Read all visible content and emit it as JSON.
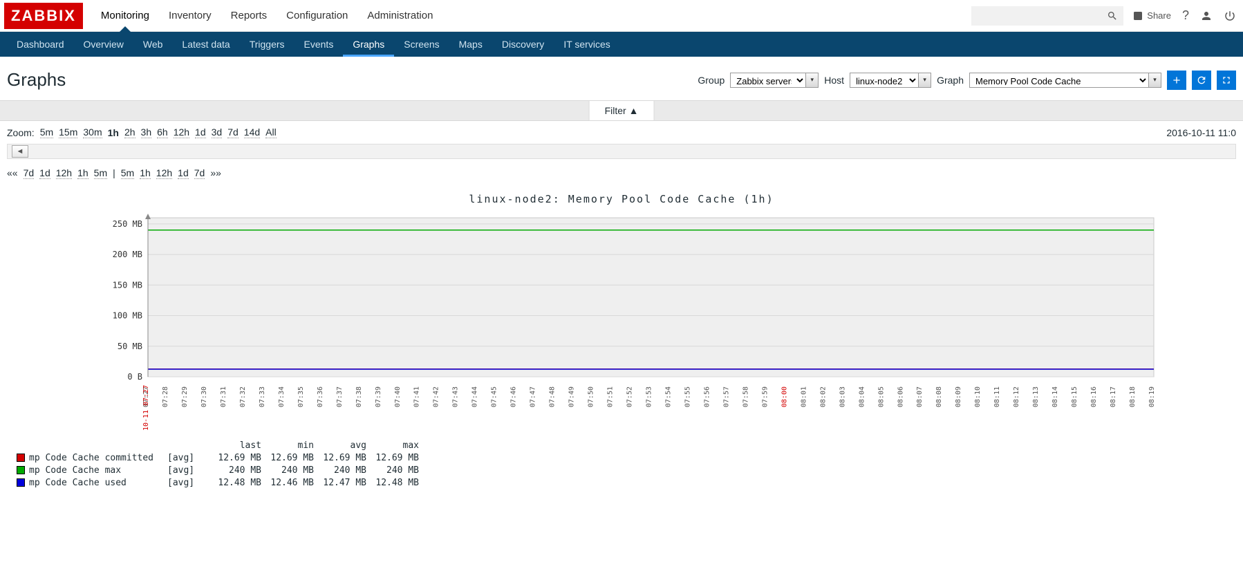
{
  "logo_text": "ZABBIX",
  "topnav": {
    "items": [
      "Monitoring",
      "Inventory",
      "Reports",
      "Configuration",
      "Administration"
    ],
    "active": "Monitoring",
    "share_label": "Share"
  },
  "subnav": {
    "items": [
      "Dashboard",
      "Overview",
      "Web",
      "Latest data",
      "Triggers",
      "Events",
      "Graphs",
      "Screens",
      "Maps",
      "Discovery",
      "IT services"
    ],
    "active": "Graphs"
  },
  "page_title": "Graphs",
  "selectors": {
    "group_label": "Group",
    "group_value": "Zabbix servers",
    "host_label": "Host",
    "host_value": "linux-node2",
    "graph_label": "Graph",
    "graph_value": "Memory Pool Code Cache"
  },
  "filter_label": "Filter ▲",
  "zoom": {
    "label": "Zoom:",
    "options": [
      "5m",
      "15m",
      "30m",
      "1h",
      "2h",
      "3h",
      "6h",
      "12h",
      "1d",
      "3d",
      "7d",
      "14d",
      "All"
    ],
    "active": "1h",
    "to_label": "2016-10-11 11:0"
  },
  "shift": {
    "left_marker": "««",
    "left": [
      "7d",
      "1d",
      "12h",
      "1h",
      "5m"
    ],
    "sep": "|",
    "right": [
      "5m",
      "1h",
      "12h",
      "1d",
      "7d"
    ],
    "right_marker": "»»"
  },
  "chart_data": {
    "type": "line",
    "title": "linux-node2: Memory Pool Code Cache (1h)",
    "ylabel": "",
    "yticks": [
      "0 B",
      "50 MB",
      "100 MB",
      "150 MB",
      "200 MB",
      "250 MB"
    ],
    "ylim_mb": [
      0,
      260
    ],
    "xticks": [
      "07:27",
      "07:28",
      "07:29",
      "07:30",
      "07:31",
      "07:32",
      "07:33",
      "07:34",
      "07:35",
      "07:36",
      "07:37",
      "07:38",
      "07:39",
      "07:40",
      "07:41",
      "07:42",
      "07:43",
      "07:44",
      "07:45",
      "07:46",
      "07:47",
      "07:48",
      "07:49",
      "07:50",
      "07:51",
      "07:52",
      "07:53",
      "07:54",
      "07:55",
      "07:56",
      "07:57",
      "07:58",
      "07:59",
      "08:00",
      "08:01",
      "08:02",
      "08:03",
      "08:04",
      "08:05",
      "08:06",
      "08:07",
      "08:08",
      "08:09",
      "08:10",
      "08:11",
      "08:12",
      "08:13",
      "08:14",
      "08:15",
      "08:16",
      "08:17",
      "08:18",
      "08:19"
    ],
    "x_date_label": "10-11",
    "highlight_xtick": "08:00",
    "series": [
      {
        "name": "mp Code Cache committed",
        "agg": "[avg]",
        "color": "#d40000",
        "value_mb": 12.69,
        "last": "12.69 MB",
        "min": "12.69 MB",
        "avg": "12.69 MB",
        "max": "12.69 MB"
      },
      {
        "name": "mp Code Cache max",
        "agg": "[avg]",
        "color": "#00aa00",
        "value_mb": 240,
        "last": "240 MB",
        "min": "240 MB",
        "avg": "240 MB",
        "max": "240 MB"
      },
      {
        "name": "mp Code Cache used",
        "agg": "[avg]",
        "color": "#0000dd",
        "value_mb": 12.47,
        "last": "12.48 MB",
        "min": "12.46 MB",
        "avg": "12.47 MB",
        "max": "12.48 MB"
      }
    ],
    "legend_headers": [
      "last",
      "min",
      "avg",
      "max"
    ]
  }
}
